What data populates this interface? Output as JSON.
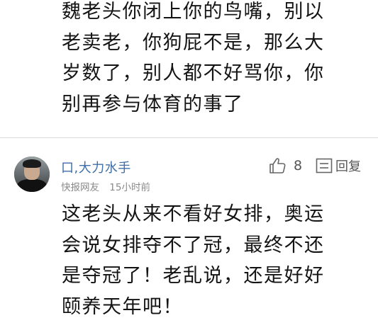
{
  "top_comment": {
    "lines": [
      "魏老头你闭上你的鸟嘴，别以",
      "老卖老，你狗屁不是，那么大",
      "岁数了，别人都不好骂你，你",
      "别再参与体育的事了"
    ]
  },
  "comment": {
    "username": "口,大力水手",
    "source": "快报网友",
    "time": "15小时前",
    "likes": "8",
    "reply_label": "回复",
    "lines": [
      "这老头从来不看好女排，奥运",
      "会说女排夺不了冠，最终不还",
      "是夺冠了！老乱说，还是好好",
      "颐养天年吧！"
    ]
  },
  "icons": {
    "like": "thumbs-up-icon",
    "reply": "reply-icon",
    "avatar": "avatar-photo"
  },
  "colors": {
    "username": "#3f6ea8",
    "meta": "#8a8a8a",
    "body_text": "#141414",
    "icon": "#666666"
  }
}
